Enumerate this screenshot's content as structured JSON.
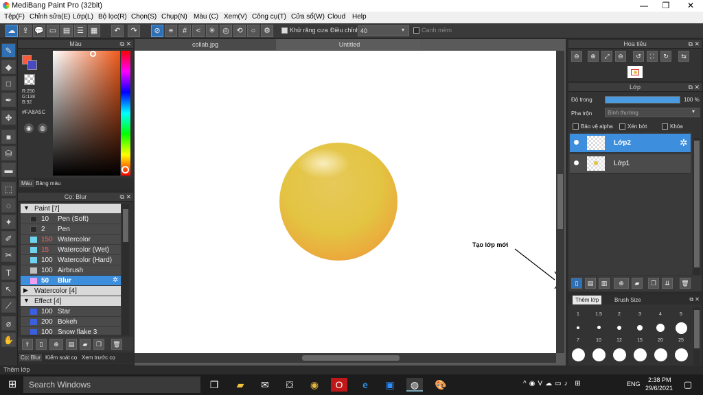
{
  "window": {
    "title": "MediBang Paint Pro (32bit)",
    "min": "—",
    "max": "❐",
    "close": "✕"
  },
  "menu": [
    "Tệp(F)",
    "Chỉnh sửa(E)",
    "Lớp(L)",
    "Bộ lọc(R)",
    "Chọn(S)",
    "Chụp(N)",
    "Màu (C)",
    "Xem(V)",
    "Công cụ(T)",
    "Cửa sổ(W)",
    "Cloud",
    "Help"
  ],
  "toolbar": {
    "antialias_label": "Khử răng cưa",
    "correction_label": "Điều chỉnh",
    "correction_value": "40",
    "snap_label": "Canh mềm"
  },
  "color_panel": {
    "title": "Màu",
    "rgb_r": "R:250",
    "rgb_g": "G:138",
    "rgb_b": "B:92",
    "hex": "#FA8A5C",
    "tab_color": "Màu",
    "tab_palette": "Bảng màu",
    "accent": "#FA8A5C"
  },
  "brush_panel": {
    "title": "Cọ: Blur",
    "groups": [
      {
        "name": "Paint [7]",
        "expanded": true,
        "items": [
          {
            "size": "10",
            "name": "Pen (Soft)",
            "color": "#2a2a2a"
          },
          {
            "size": "2",
            "name": "Pen",
            "color": "#2a2a2a"
          },
          {
            "size": "150",
            "name": "Watercolor",
            "color": "#6fd3f0"
          },
          {
            "size": "15",
            "name": "Watercolor (Wet)",
            "color": "#6fd3f0"
          },
          {
            "size": "100",
            "name": "Watercolor (Hard)",
            "color": "#6fd3f0"
          },
          {
            "size": "100",
            "name": "Airbrush",
            "color": "#bfbfbf"
          },
          {
            "size": "50",
            "name": "Blur",
            "color": "#f0a0f0",
            "selected": true
          }
        ]
      },
      {
        "name": "Watercolor [4]",
        "expanded": false,
        "items": []
      },
      {
        "name": "Effect [4]",
        "expanded": true,
        "items": [
          {
            "size": "100",
            "name": "Star",
            "color": "#3a5fe0"
          },
          {
            "size": "200",
            "name": "Bokeh",
            "color": "#3a5fe0"
          },
          {
            "size": "100",
            "name": "Snow flake 3",
            "color": "#3a5fe0"
          }
        ]
      }
    ],
    "bottom_tabs": [
      "Cọ: Blur",
      "Kiểm soát cọ",
      "Xem trước cọ"
    ]
  },
  "documents": {
    "tabs": [
      "collab.jpg",
      "Untitled"
    ],
    "active": "Untitled"
  },
  "annotation": {
    "text": "Tạo lớp mới"
  },
  "navigator": {
    "title": "Hoa tiêu"
  },
  "layer_panel": {
    "title": "Lớp",
    "opacity_label": "Độ trong",
    "opacity_value": "100 %",
    "opacity": 1.0,
    "blend_label": "Pha trộn",
    "blend_value": "Bình thường",
    "protect_alpha": "Bảo vệ alpha",
    "clipping": "Xén bớt",
    "lock": "Khóa",
    "layers": [
      {
        "name": "Lớp2",
        "selected": true
      },
      {
        "name": "Lớp1",
        "selected": false
      }
    ]
  },
  "brush_size_panel": {
    "tab_add_layer": "Thêm lớp",
    "tab_brush_size": "Brush Size",
    "row1": [
      "1",
      "1.5",
      "2",
      "3",
      "4",
      "5"
    ],
    "row2": [
      "7",
      "10",
      "12",
      "15",
      "20",
      "25"
    ]
  },
  "status": {
    "text": "Thêm lớp"
  },
  "taskbar": {
    "search": "Search Windows",
    "lang": "ENG",
    "time": "2:38 PM",
    "date": "29/6/2021"
  }
}
